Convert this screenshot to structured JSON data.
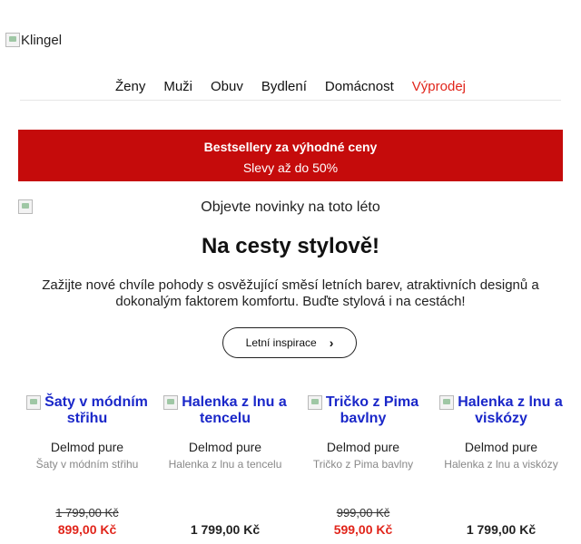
{
  "logo": {
    "alt": "Klingel"
  },
  "nav": [
    {
      "label": "Ženy"
    },
    {
      "label": "Muži"
    },
    {
      "label": "Obuv"
    },
    {
      "label": "Bydlení"
    },
    {
      "label": "Domácnost"
    },
    {
      "label": "Výprodej"
    }
  ],
  "banner": {
    "line1": "Bestsellery za výhodné ceny",
    "line2": "Slevy až do 50%"
  },
  "hero": {
    "image_alt": "Objevte novinky na toto léto",
    "headline": "Na cesty stylově!",
    "lead": "Zažijte nové chvíle pohody s osvěžující směsí letních barev, atraktivních designů a dokonalým faktorem komfortu. Buďte stylová i na cestách!",
    "cta": "Letní inspirace",
    "cta_icon": "chevron-right-icon"
  },
  "products": [
    {
      "title": "Šaty v módním střihu",
      "brand": "Delmod pure",
      "sub": "Šaty v módním střihu",
      "old_price": "1 799,00 Kč",
      "price": "899,00 Kč",
      "on_sale": true
    },
    {
      "title": "Halenka z lnu a tencelu",
      "brand": "Delmod pure",
      "sub": "Halenka z lnu a tencelu",
      "old_price": "",
      "price": "1 799,00 Kč",
      "on_sale": false
    },
    {
      "title": "Tričko z Pima bavlny",
      "brand": "Delmod pure",
      "sub": "Tričko z Pima bavlny",
      "old_price": "999,00 Kč",
      "price": "599,00 Kč",
      "on_sale": true
    },
    {
      "title": "Halenka z lnu a viskózy",
      "brand": "Delmod pure",
      "sub": "Halenka z lnu a viskózy",
      "old_price": "",
      "price": "1 799,00 Kč",
      "on_sale": false
    }
  ],
  "colors": {
    "sale_red": "#e1251b",
    "banner_red": "#c50b0b",
    "link_blue": "#1a27c9"
  }
}
